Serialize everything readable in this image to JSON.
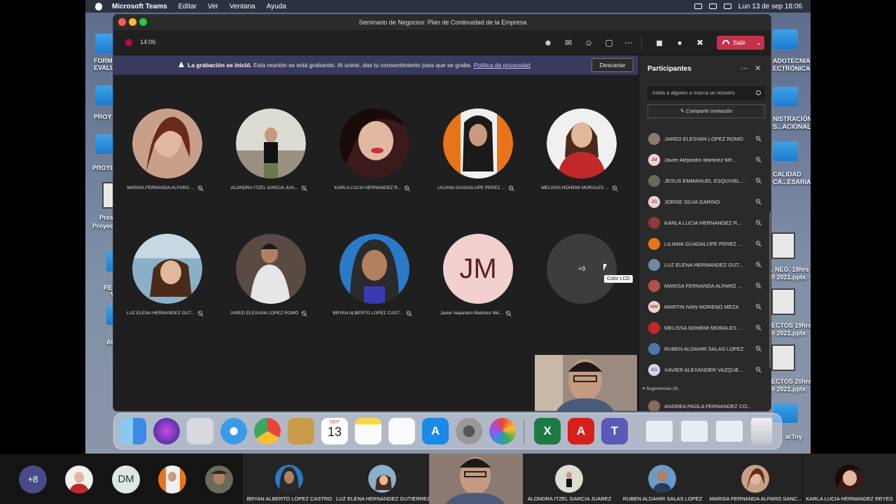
{
  "menubar": {
    "app": "Microsoft Teams",
    "menus": [
      "Editar",
      "Ver",
      "Ventana",
      "Ayuda"
    ],
    "date_time": "Lun 13 de sep  18:06"
  },
  "desktop_labels": [
    "FORM",
    "EVALU",
    "PROY",
    "PROYE",
    "Pres",
    "Proyec",
    "RES",
    "V",
    "AC",
    "ADOTECNIA",
    "ECTRÓNICA",
    "NISTRACIÓN",
    "S...ACIONAL",
    "CALIDAD",
    "CA...ESARIAL",
    ". NEG. 18hrs",
    "0 2021.pptx",
    "ECTOS 19hrs",
    "0 2021.pptx",
    "ECTOS 20hrs",
    "0 2021.pptx",
    "arToy"
  ],
  "window": {
    "title": "Seminario de Negocios: Plan de Continuidad de la Empresa",
    "timer": "14:06",
    "leave_label": "Salir"
  },
  "banner": {
    "bold": "La grabación se inició.",
    "text": "Esta reunión se está grabando. Al unirte, das tu consentimiento para que se grabe.",
    "link": "Política de privacidad",
    "discard": "Descartar"
  },
  "grid": [
    {
      "name": "MARISA FERNANDA ALFARO ...",
      "color": "#b8504a"
    },
    {
      "name": "ALONDRA ITZEL GARCIA JUA...",
      "color": "#6f6a55"
    },
    {
      "name": "KARLA LUCIA HERNANDEZ R...",
      "color": "#8a3a3a"
    },
    {
      "name": "LILIANA GUADALUPE PEREZ ...",
      "color": "#e8741a"
    },
    {
      "name": "MELISSA NOHEMI MORALES ...",
      "color": "#c0282a"
    },
    {
      "name": "LUZ ELENA HERNANDEZ GUT...",
      "color": "#6a8aa8"
    },
    {
      "name": "JARED ELESVAN LOPEZ ROMO",
      "color": "#8a7a70"
    },
    {
      "name": "BRYAN ALBERTO LOPEZ CAST...",
      "color": "#2a6aa8"
    },
    {
      "name": "Javier Alejandro Martinez Mé...",
      "initials": "JM"
    },
    {
      "name": "",
      "initials": "+9"
    }
  ],
  "tooltip": "Color LCD",
  "panel": {
    "title": "Participantes",
    "invite_placeholder": "Invita a alguien o marca un número",
    "share_label": "Compartir invitación",
    "participants": [
      {
        "name": "JARED ELESVAN LOPEZ ROMO",
        "initials": "",
        "color": "#8a7a70"
      },
      {
        "name": "Javier Alejandro Martinez Mé...",
        "initials": "JM",
        "color": "#f2d0d0"
      },
      {
        "name": "JESUS EMMANUEL ESQUIVEL ...",
        "initials": "",
        "color": "#6a6a5a"
      },
      {
        "name": "JORGE SILVA GARINO",
        "initials": "JG",
        "color": "#f2d0d0"
      },
      {
        "name": "KARLA LUCIA HERNANDEZ R...",
        "initials": "",
        "color": "#8a3a3a"
      },
      {
        "name": "LILIANA GUADALUPE PEREZ ...",
        "initials": "",
        "color": "#e8741a"
      },
      {
        "name": "LUZ ELENA HERNANDEZ GUT...",
        "initials": "",
        "color": "#6a8aa8"
      },
      {
        "name": "MARISA FERNANDA ALFARO ...",
        "initials": "",
        "color": "#b8504a"
      },
      {
        "name": "MARTIN IVAN MORENO MEZA",
        "initials": "MM",
        "color": "#f2d0d0"
      },
      {
        "name": "MELISSA NOHEMI MORALES ...",
        "initials": "",
        "color": "#c0282a"
      },
      {
        "name": "RUBEN ALDAHIR SALAS LOPEZ",
        "initials": "",
        "color": "#4a7aa8"
      },
      {
        "name": "XAVIER ALEXANDER VAZQUE...",
        "initials": "XG",
        "color": "#d8d8e8"
      },
      {
        "name": "ANDREA PAOLA FERNANDEZ CO...",
        "initials": "",
        "color": "#8a6a5a"
      }
    ],
    "suggestions": "Sugerencias (4)"
  },
  "dock": {
    "calendar_month": "SEP",
    "calendar_day": "13"
  },
  "strip": {
    "overflow": "+8",
    "dm": "DM",
    "tiles": [
      "BRYAN ALBERTO LOPEZ CASTRO",
      "LUZ ELENA HERNANDEZ GUTIERREZ",
      "ALONDRA ITZEL GARCIA JUAREZ",
      "RUBEN ALDAHIR SALAS LOPEZ",
      "MARISA FERNANDA ALFARO SANC...",
      "KARLA LUCIA HERNANDEZ REYES"
    ]
  }
}
